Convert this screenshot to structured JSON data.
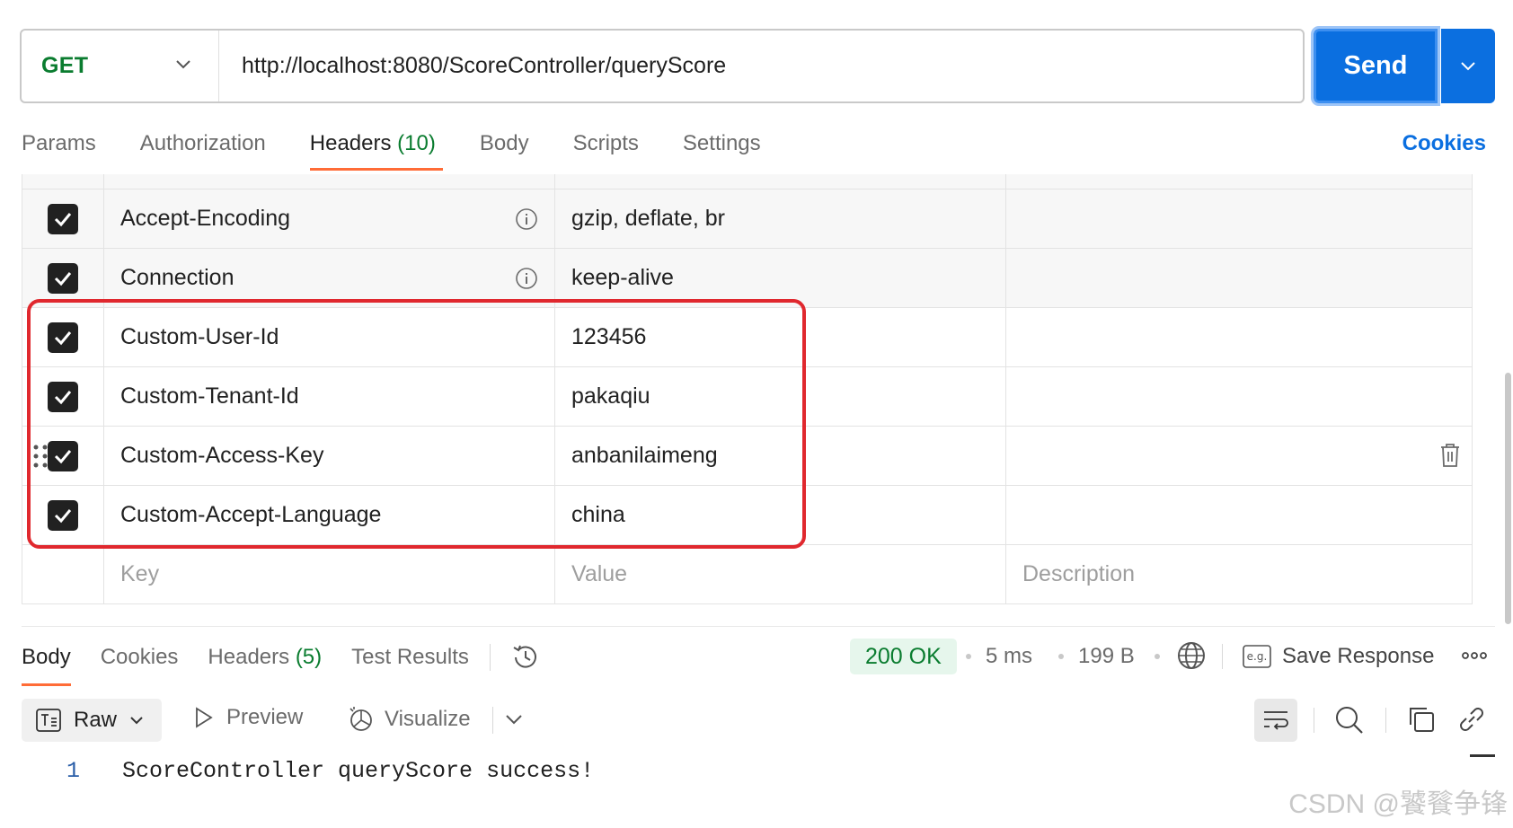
{
  "request": {
    "method": "GET",
    "url": "http://localhost:8080/ScoreController/queryScore",
    "send_label": "Send"
  },
  "request_tabs": [
    {
      "label": "Params",
      "count": ""
    },
    {
      "label": "Authorization",
      "count": ""
    },
    {
      "label": "Headers",
      "count": "(10)",
      "active": true
    },
    {
      "label": "Body",
      "count": ""
    },
    {
      "label": "Scripts",
      "count": ""
    },
    {
      "label": "Settings",
      "count": ""
    }
  ],
  "cookies_link": "Cookies",
  "headers": {
    "rows": [
      {
        "key": "Accept-Encoding",
        "value": "gzip, deflate, br",
        "auto": true
      },
      {
        "key": "Connection",
        "value": "keep-alive",
        "auto": true
      },
      {
        "key": "Custom-User-Id",
        "value": "123456"
      },
      {
        "key": "Custom-Tenant-Id",
        "value": "pakaqiu"
      },
      {
        "key": "Custom-Access-Key",
        "value": "anbanilaimeng"
      },
      {
        "key": "Custom-Accept-Language",
        "value": "china"
      }
    ],
    "placeholder_key": "Key",
    "placeholder_value": "Value",
    "placeholder_desc": "Description"
  },
  "response": {
    "tabs": {
      "body": "Body",
      "cookies": "Cookies",
      "headers": "Headers",
      "headers_count": "(5)",
      "test_results": "Test Results"
    },
    "status": "200 OK",
    "time": "5 ms",
    "size": "199 B",
    "save_label": "Save Response",
    "format": "Raw",
    "preview": "Preview",
    "visualize": "Visualize",
    "line_number": "1",
    "body_text": "ScoreController queryScore success!"
  },
  "watermark": "CSDN @饕餮争锋",
  "colors": {
    "accent_blue": "#0b6fe0",
    "method_green": "#0a7c2f",
    "tab_underline": "#ff6c37",
    "highlight_red": "#e0282e"
  }
}
